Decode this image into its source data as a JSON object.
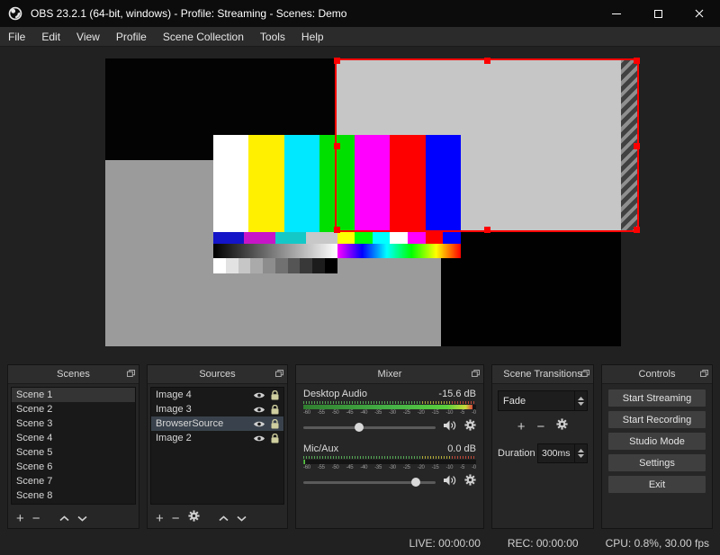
{
  "window": {
    "title": "OBS 23.2.1 (64-bit, windows) - Profile: Streaming - Scenes: Demo"
  },
  "menu": {
    "file": "File",
    "edit": "Edit",
    "view": "View",
    "profile": "Profile",
    "scene_collection": "Scene Collection",
    "tools": "Tools",
    "help": "Help"
  },
  "icons": {
    "plus": "+",
    "minus": "−"
  },
  "preview": {
    "selection_color": "#ff0000",
    "color_bars": [
      "#ffffff",
      "#fff000",
      "#00e8ff",
      "#00e000",
      "#ff00ff",
      "#ff0000",
      "#0000ff"
    ],
    "strip1_left": [
      "#1414c8",
      "#c814c8",
      "#14c8c8",
      "#c8c8c8"
    ],
    "strip1_right": [
      "#ffff00",
      "#00ff00",
      "#00ffff",
      "#ffffff",
      "#ff00ff",
      "#ff0000",
      "#0000ff"
    ],
    "gray_steps": [
      "#ffffff",
      "#e2e2e2",
      "#c6c6c6",
      "#aaaaaa",
      "#8d8d8d",
      "#717171",
      "#555555",
      "#383838",
      "#1c1c1c",
      "#000000"
    ]
  },
  "scenes": {
    "title": "Scenes",
    "items": [
      "Scene 1",
      "Scene 2",
      "Scene 3",
      "Scene 4",
      "Scene 5",
      "Scene 6",
      "Scene 7",
      "Scene 8"
    ],
    "selected": "Scene 1"
  },
  "sources": {
    "title": "Sources",
    "items": [
      "Image 4",
      "Image 3",
      "BrowserSource",
      "Image 2"
    ],
    "selected": "BrowserSource"
  },
  "mixer": {
    "title": "Mixer",
    "channels": [
      {
        "name": "Desktop Audio",
        "level": "-15.6 dB",
        "meter_percent": 98,
        "slider_percent": 42
      },
      {
        "name": "Mic/Aux",
        "level": "0.0 dB",
        "meter_percent": 1,
        "slider_percent": 85
      }
    ],
    "scale": [
      "-60",
      "-55",
      "-50",
      "-45",
      "-40",
      "-35",
      "-30",
      "-25",
      "-20",
      "-15",
      "-10",
      "-5",
      "-0"
    ]
  },
  "transitions": {
    "title": "Scene Transitions",
    "selected": "Fade",
    "duration_label": "Duration",
    "duration_value": "300ms"
  },
  "controls": {
    "title": "Controls",
    "start_streaming": "Start Streaming",
    "start_recording": "Start Recording",
    "studio_mode": "Studio Mode",
    "settings": "Settings",
    "exit": "Exit"
  },
  "statusbar": {
    "live": "LIVE: 00:00:00",
    "rec": "REC: 00:00:00",
    "cpu": "CPU: 0.8%, 30.00 fps"
  }
}
